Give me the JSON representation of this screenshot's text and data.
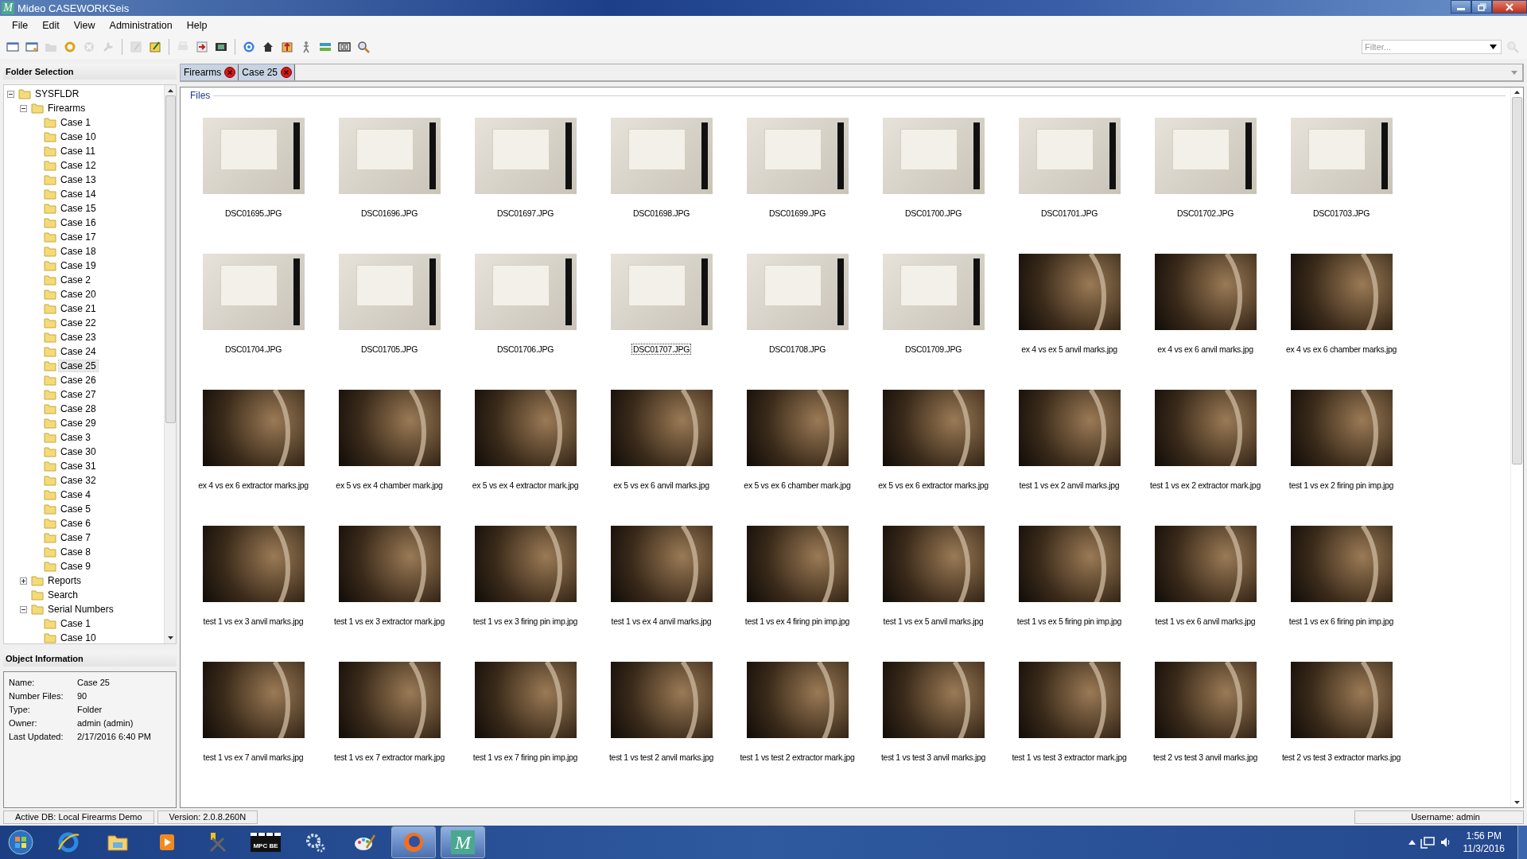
{
  "window": {
    "logo": "M",
    "title": "Mideo CASEWORKSeis"
  },
  "menu": [
    "File",
    "Edit",
    "View",
    "Administration",
    "Help"
  ],
  "toolbar": [
    [
      {
        "kind": "window",
        "disabled": false
      },
      {
        "kind": "window-star",
        "disabled": false
      },
      {
        "kind": "folder",
        "disabled": true
      },
      {
        "kind": "ring",
        "disabled": false
      },
      {
        "kind": "cross-circle",
        "disabled": true
      },
      {
        "kind": "wrench",
        "disabled": true
      }
    ],
    [
      {
        "kind": "pencil-page",
        "disabled": true
      },
      {
        "kind": "pencil-note",
        "disabled": false
      }
    ],
    [
      {
        "kind": "printer",
        "disabled": true
      },
      {
        "kind": "import",
        "disabled": false
      },
      {
        "kind": "film",
        "disabled": false
      }
    ],
    [
      {
        "kind": "globe",
        "disabled": false
      },
      {
        "kind": "house",
        "disabled": false
      },
      {
        "kind": "upload",
        "disabled": false
      },
      {
        "kind": "figure",
        "disabled": false
      },
      {
        "kind": "layers",
        "disabled": false
      },
      {
        "kind": "frame",
        "disabled": false
      },
      {
        "kind": "magnifier",
        "disabled": false
      }
    ]
  ],
  "filter": {
    "placeholder": "Filter..."
  },
  "folder_panel": {
    "title": "Folder Selection",
    "tree": [
      {
        "label": "SYSFLDR",
        "expanded": true,
        "selected": false,
        "children": [
          {
            "label": "Firearms",
            "expanded": true,
            "selected": false,
            "children": [
              {
                "label": "Case 1",
                "selected": false
              },
              {
                "label": "Case 10",
                "selected": false
              },
              {
                "label": "Case 11",
                "selected": false
              },
              {
                "label": "Case 12",
                "selected": false
              },
              {
                "label": "Case 13",
                "selected": false
              },
              {
                "label": "Case 14",
                "selected": false
              },
              {
                "label": "Case 15",
                "selected": false
              },
              {
                "label": "Case 16",
                "selected": false
              },
              {
                "label": "Case 17",
                "selected": false
              },
              {
                "label": "Case 18",
                "selected": false
              },
              {
                "label": "Case 19",
                "selected": false
              },
              {
                "label": "Case 2",
                "selected": false
              },
              {
                "label": "Case 20",
                "selected": false
              },
              {
                "label": "Case 21",
                "selected": false
              },
              {
                "label": "Case 22",
                "selected": false
              },
              {
                "label": "Case 23",
                "selected": false
              },
              {
                "label": "Case 24",
                "selected": false
              },
              {
                "label": "Case 25",
                "selected": true
              },
              {
                "label": "Case 26",
                "selected": false
              },
              {
                "label": "Case 27",
                "selected": false
              },
              {
                "label": "Case 28",
                "selected": false
              },
              {
                "label": "Case 29",
                "selected": false
              },
              {
                "label": "Case 3",
                "selected": false
              },
              {
                "label": "Case 30",
                "selected": false
              },
              {
                "label": "Case 31",
                "selected": false
              },
              {
                "label": "Case 32",
                "selected": false
              },
              {
                "label": "Case 4",
                "selected": false
              },
              {
                "label": "Case 5",
                "selected": false
              },
              {
                "label": "Case 6",
                "selected": false
              },
              {
                "label": "Case 7",
                "selected": false
              },
              {
                "label": "Case 8",
                "selected": false
              },
              {
                "label": "Case 9",
                "selected": false
              }
            ]
          },
          {
            "label": "Reports",
            "expanded": false,
            "selected": false
          },
          {
            "label": "Search",
            "selected": false
          },
          {
            "label": "Serial Numbers",
            "expanded": true,
            "selected": false,
            "children": [
              {
                "label": "Case 1",
                "selected": false
              },
              {
                "label": "Case 10",
                "selected": false
              }
            ]
          }
        ]
      }
    ]
  },
  "object_info": {
    "title": "Object Information",
    "fields": [
      {
        "label": "Name:",
        "value": "Case 25"
      },
      {
        "label": "Number Files:",
        "value": "90"
      },
      {
        "label": "Type:",
        "value": "Folder"
      },
      {
        "label": "Owner:",
        "value": "admin (admin)"
      },
      {
        "label": "Last Updated:",
        "value": "2/17/2016 6:40 PM"
      }
    ]
  },
  "tabs": [
    "Firearms",
    "Case 25"
  ],
  "files": {
    "title": "Files",
    "items": [
      {
        "name": "DSC01695.JPG",
        "kind": "photo",
        "selected": false
      },
      {
        "name": "DSC01696.JPG",
        "kind": "photo",
        "selected": false
      },
      {
        "name": "DSC01697.JPG",
        "kind": "photo",
        "selected": false
      },
      {
        "name": "DSC01698.JPG",
        "kind": "photo",
        "selected": false
      },
      {
        "name": "DSC01699.JPG",
        "kind": "photo",
        "selected": false
      },
      {
        "name": "DSC01700.JPG",
        "kind": "photo",
        "selected": false
      },
      {
        "name": "DSC01701.JPG",
        "kind": "photo",
        "selected": false
      },
      {
        "name": "DSC01702.JPG",
        "kind": "photo",
        "selected": false
      },
      {
        "name": "DSC01703.JPG",
        "kind": "photo",
        "selected": false
      },
      {
        "name": "DSC01704.JPG",
        "kind": "photo",
        "selected": false
      },
      {
        "name": "DSC01705.JPG",
        "kind": "photo",
        "selected": false
      },
      {
        "name": "DSC01706.JPG",
        "kind": "photo",
        "selected": false
      },
      {
        "name": "DSC01707.JPG",
        "kind": "photo",
        "selected": true
      },
      {
        "name": "DSC01708.JPG",
        "kind": "photo",
        "selected": false
      },
      {
        "name": "DSC01709.JPG",
        "kind": "photo",
        "selected": false
      },
      {
        "name": "ex 4 vs ex 5 anvil marks.jpg",
        "kind": "micrograph",
        "selected": false
      },
      {
        "name": "ex 4 vs ex 6 anvil marks.jpg",
        "kind": "micrograph",
        "selected": false
      },
      {
        "name": "ex 4 vs ex 6 chamber marks.jpg",
        "kind": "micrograph",
        "selected": false
      },
      {
        "name": "ex 4 vs ex 6 extractor marks.jpg",
        "kind": "micrograph",
        "selected": false
      },
      {
        "name": "ex 5 vs ex 4 chamber mark.jpg",
        "kind": "micrograph",
        "selected": false
      },
      {
        "name": "ex 5 vs ex 4 extractor mark.jpg",
        "kind": "micrograph",
        "selected": false
      },
      {
        "name": "ex 5 vs ex 6 anvil marks.jpg",
        "kind": "micrograph",
        "selected": false
      },
      {
        "name": "ex 5 vs ex 6 chamber mark.jpg",
        "kind": "micrograph",
        "selected": false
      },
      {
        "name": "ex 5 vs ex 6 extractor marks.jpg",
        "kind": "micrograph",
        "selected": false
      },
      {
        "name": "test 1 vs ex 2 anvil marks.jpg",
        "kind": "micrograph",
        "selected": false
      },
      {
        "name": "test 1 vs ex 2 extractor mark.jpg",
        "kind": "micrograph",
        "selected": false
      },
      {
        "name": "test 1 vs ex 2 firing pin imp.jpg",
        "kind": "micrograph",
        "selected": false
      },
      {
        "name": "test 1 vs ex 3 anvil marks.jpg",
        "kind": "micrograph",
        "selected": false
      },
      {
        "name": "test 1 vs ex 3 extractor mark.jpg",
        "kind": "micrograph",
        "selected": false
      },
      {
        "name": "test 1 vs ex 3 firing pin imp.jpg",
        "kind": "micrograph",
        "selected": false
      },
      {
        "name": "test 1 vs ex 4 anvil marks.jpg",
        "kind": "micrograph",
        "selected": false
      },
      {
        "name": "test 1 vs ex 4 firing pin imp.jpg",
        "kind": "micrograph",
        "selected": false
      },
      {
        "name": "test 1 vs ex 5 anvil marks.jpg",
        "kind": "micrograph",
        "selected": false
      },
      {
        "name": "test 1 vs ex 5 firing pin imp.jpg",
        "kind": "micrograph",
        "selected": false
      },
      {
        "name": "test 1 vs ex 6 anvil marks.jpg",
        "kind": "micrograph",
        "selected": false
      },
      {
        "name": "test 1 vs ex 6 firing pin imp.jpg",
        "kind": "micrograph",
        "selected": false
      },
      {
        "name": "test 1 vs ex 7 anvil marks.jpg",
        "kind": "micrograph",
        "selected": false
      },
      {
        "name": "test 1 vs ex 7 extractor mark.jpg",
        "kind": "micrograph",
        "selected": false
      },
      {
        "name": "test 1 vs ex 7 firing pin imp.jpg",
        "kind": "micrograph",
        "selected": false
      },
      {
        "name": "test 1 vs test 2 anvil marks.jpg",
        "kind": "micrograph",
        "selected": false
      },
      {
        "name": "test 1 vs test 2 extractor mark.jpg",
        "kind": "micrograph",
        "selected": false
      },
      {
        "name": "test 1 vs test 3 anvil marks.jpg",
        "kind": "micrograph",
        "selected": false
      },
      {
        "name": "test 1 vs test 3 extractor mark.jpg",
        "kind": "micrograph",
        "selected": false
      },
      {
        "name": "test 2 vs test 3 anvil marks.jpg",
        "kind": "micrograph",
        "selected": false
      },
      {
        "name": "test 2 vs test 3 extractor marks.jpg",
        "kind": "micrograph",
        "selected": false
      }
    ]
  },
  "status_bar": {
    "database": "Active DB: Local Firearms Demo",
    "version": "Version: 2.0.8.260N",
    "user": "Username: admin"
  },
  "taskbar": {
    "items": [
      {
        "kind": "browser",
        "running": false
      },
      {
        "kind": "folder",
        "running": false
      },
      {
        "kind": "media-player",
        "running": false
      },
      {
        "kind": "tools",
        "running": false
      },
      {
        "kind": "clapperboard",
        "label": "MPC BE",
        "running": false
      },
      {
        "kind": "gears",
        "running": false
      },
      {
        "kind": "palette",
        "running": false
      },
      {
        "kind": "globe",
        "running": true
      },
      {
        "kind": "app-logo",
        "label": "M",
        "running": true
      }
    ],
    "time": "1:56 PM",
    "date": "11/3/2016"
  }
}
